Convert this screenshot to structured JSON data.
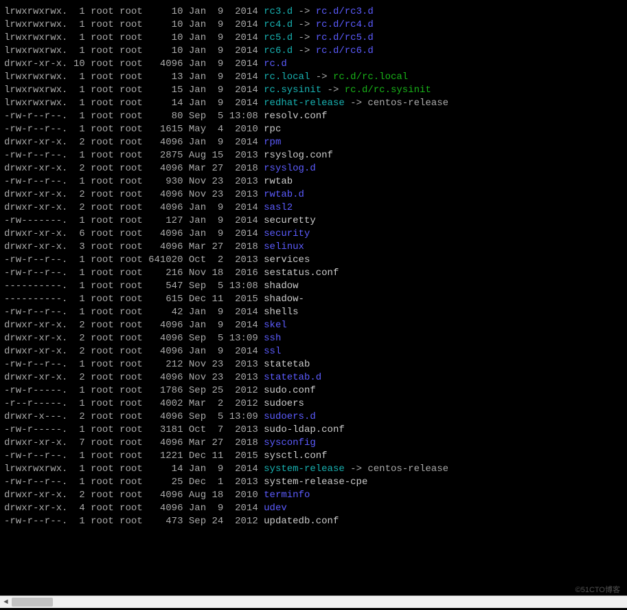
{
  "watermark": "©51CTO博客",
  "rows": [
    {
      "perm": "lrwxrwxrwx.",
      "links": "1",
      "owner": "root",
      "group": "root",
      "size": "10",
      "month": "Jan",
      "day": "9",
      "time": "2014",
      "name": "rc3.d",
      "nameType": "link",
      "arrow": " -> ",
      "target": "rc.d/rc3.d",
      "targetType": "dir"
    },
    {
      "perm": "lrwxrwxrwx.",
      "links": "1",
      "owner": "root",
      "group": "root",
      "size": "10",
      "month": "Jan",
      "day": "9",
      "time": "2014",
      "name": "rc4.d",
      "nameType": "link",
      "arrow": " -> ",
      "target": "rc.d/rc4.d",
      "targetType": "dir"
    },
    {
      "perm": "lrwxrwxrwx.",
      "links": "1",
      "owner": "root",
      "group": "root",
      "size": "10",
      "month": "Jan",
      "day": "9",
      "time": "2014",
      "name": "rc5.d",
      "nameType": "link",
      "arrow": " -> ",
      "target": "rc.d/rc5.d",
      "targetType": "dir"
    },
    {
      "perm": "lrwxrwxrwx.",
      "links": "1",
      "owner": "root",
      "group": "root",
      "size": "10",
      "month": "Jan",
      "day": "9",
      "time": "2014",
      "name": "rc6.d",
      "nameType": "link",
      "arrow": " -> ",
      "target": "rc.d/rc6.d",
      "targetType": "dir"
    },
    {
      "perm": "drwxr-xr-x.",
      "links": "10",
      "owner": "root",
      "group": "root",
      "size": "4096",
      "month": "Jan",
      "day": "9",
      "time": "2014",
      "name": "rc.d",
      "nameType": "dir"
    },
    {
      "perm": "lrwxrwxrwx.",
      "links": "1",
      "owner": "root",
      "group": "root",
      "size": "13",
      "month": "Jan",
      "day": "9",
      "time": "2014",
      "name": "rc.local",
      "nameType": "link",
      "arrow": " -> ",
      "target": "rc.d/rc.local",
      "targetType": "exec"
    },
    {
      "perm": "lrwxrwxrwx.",
      "links": "1",
      "owner": "root",
      "group": "root",
      "size": "15",
      "month": "Jan",
      "day": "9",
      "time": "2014",
      "name": "rc.sysinit",
      "nameType": "link",
      "arrow": " -> ",
      "target": "rc.d/rc.sysinit",
      "targetType": "exec"
    },
    {
      "perm": "lrwxrwxrwx.",
      "links": "1",
      "owner": "root",
      "group": "root",
      "size": "14",
      "month": "Jan",
      "day": "9",
      "time": "2014",
      "name": "redhat-release",
      "nameType": "link",
      "arrow": " -> ",
      "target": "centos-release",
      "targetType": "plain"
    },
    {
      "perm": "-rw-r--r--.",
      "links": "1",
      "owner": "root",
      "group": "root",
      "size": "80",
      "month": "Sep",
      "day": "5",
      "time": "13:08",
      "name": "resolv.conf",
      "nameType": "plain"
    },
    {
      "perm": "-rw-r--r--.",
      "links": "1",
      "owner": "root",
      "group": "root",
      "size": "1615",
      "month": "May",
      "day": "4",
      "time": "2010",
      "name": "rpc",
      "nameType": "plain"
    },
    {
      "perm": "drwxr-xr-x.",
      "links": "2",
      "owner": "root",
      "group": "root",
      "size": "4096",
      "month": "Jan",
      "day": "9",
      "time": "2014",
      "name": "rpm",
      "nameType": "dir"
    },
    {
      "perm": "-rw-r--r--.",
      "links": "1",
      "owner": "root",
      "group": "root",
      "size": "2875",
      "month": "Aug",
      "day": "15",
      "time": "2013",
      "name": "rsyslog.conf",
      "nameType": "plain"
    },
    {
      "perm": "drwxr-xr-x.",
      "links": "2",
      "owner": "root",
      "group": "root",
      "size": "4096",
      "month": "Mar",
      "day": "27",
      "time": "2018",
      "name": "rsyslog.d",
      "nameType": "dir"
    },
    {
      "perm": "-rw-r--r--.",
      "links": "1",
      "owner": "root",
      "group": "root",
      "size": "930",
      "month": "Nov",
      "day": "23",
      "time": "2013",
      "name": "rwtab",
      "nameType": "plain"
    },
    {
      "perm": "drwxr-xr-x.",
      "links": "2",
      "owner": "root",
      "group": "root",
      "size": "4096",
      "month": "Nov",
      "day": "23",
      "time": "2013",
      "name": "rwtab.d",
      "nameType": "dir"
    },
    {
      "perm": "drwxr-xr-x.",
      "links": "2",
      "owner": "root",
      "group": "root",
      "size": "4096",
      "month": "Jan",
      "day": "9",
      "time": "2014",
      "name": "sasl2",
      "nameType": "dir"
    },
    {
      "perm": "-rw-------.",
      "links": "1",
      "owner": "root",
      "group": "root",
      "size": "127",
      "month": "Jan",
      "day": "9",
      "time": "2014",
      "name": "securetty",
      "nameType": "plain"
    },
    {
      "perm": "drwxr-xr-x.",
      "links": "6",
      "owner": "root",
      "group": "root",
      "size": "4096",
      "month": "Jan",
      "day": "9",
      "time": "2014",
      "name": "security",
      "nameType": "dir"
    },
    {
      "perm": "drwxr-xr-x.",
      "links": "3",
      "owner": "root",
      "group": "root",
      "size": "4096",
      "month": "Mar",
      "day": "27",
      "time": "2018",
      "name": "selinux",
      "nameType": "dir"
    },
    {
      "perm": "-rw-r--r--.",
      "links": "1",
      "owner": "root",
      "group": "root",
      "size": "641020",
      "month": "Oct",
      "day": "2",
      "time": "2013",
      "name": "services",
      "nameType": "plain"
    },
    {
      "perm": "-rw-r--r--.",
      "links": "1",
      "owner": "root",
      "group": "root",
      "size": "216",
      "month": "Nov",
      "day": "18",
      "time": "2016",
      "name": "sestatus.conf",
      "nameType": "plain"
    },
    {
      "perm": "----------.",
      "links": "1",
      "owner": "root",
      "group": "root",
      "size": "547",
      "month": "Sep",
      "day": "5",
      "time": "13:08",
      "name": "shadow",
      "nameType": "plain"
    },
    {
      "perm": "----------.",
      "links": "1",
      "owner": "root",
      "group": "root",
      "size": "615",
      "month": "Dec",
      "day": "11",
      "time": "2015",
      "name": "shadow-",
      "nameType": "plain"
    },
    {
      "perm": "-rw-r--r--.",
      "links": "1",
      "owner": "root",
      "group": "root",
      "size": "42",
      "month": "Jan",
      "day": "9",
      "time": "2014",
      "name": "shells",
      "nameType": "plain"
    },
    {
      "perm": "drwxr-xr-x.",
      "links": "2",
      "owner": "root",
      "group": "root",
      "size": "4096",
      "month": "Jan",
      "day": "9",
      "time": "2014",
      "name": "skel",
      "nameType": "dir"
    },
    {
      "perm": "drwxr-xr-x.",
      "links": "2",
      "owner": "root",
      "group": "root",
      "size": "4096",
      "month": "Sep",
      "day": "5",
      "time": "13:09",
      "name": "ssh",
      "nameType": "dir"
    },
    {
      "perm": "drwxr-xr-x.",
      "links": "2",
      "owner": "root",
      "group": "root",
      "size": "4096",
      "month": "Jan",
      "day": "9",
      "time": "2014",
      "name": "ssl",
      "nameType": "dir"
    },
    {
      "perm": "-rw-r--r--.",
      "links": "1",
      "owner": "root",
      "group": "root",
      "size": "212",
      "month": "Nov",
      "day": "23",
      "time": "2013",
      "name": "statetab",
      "nameType": "plain"
    },
    {
      "perm": "drwxr-xr-x.",
      "links": "2",
      "owner": "root",
      "group": "root",
      "size": "4096",
      "month": "Nov",
      "day": "23",
      "time": "2013",
      "name": "statetab.d",
      "nameType": "dir"
    },
    {
      "perm": "-rw-r-----.",
      "links": "1",
      "owner": "root",
      "group": "root",
      "size": "1786",
      "month": "Sep",
      "day": "25",
      "time": "2012",
      "name": "sudo.conf",
      "nameType": "plain"
    },
    {
      "perm": "-r--r-----.",
      "links": "1",
      "owner": "root",
      "group": "root",
      "size": "4002",
      "month": "Mar",
      "day": "2",
      "time": "2012",
      "name": "sudoers",
      "nameType": "plain"
    },
    {
      "perm": "drwxr-x---.",
      "links": "2",
      "owner": "root",
      "group": "root",
      "size": "4096",
      "month": "Sep",
      "day": "5",
      "time": "13:09",
      "name": "sudoers.d",
      "nameType": "dir"
    },
    {
      "perm": "-rw-r-----.",
      "links": "1",
      "owner": "root",
      "group": "root",
      "size": "3181",
      "month": "Oct",
      "day": "7",
      "time": "2013",
      "name": "sudo-ldap.conf",
      "nameType": "plain"
    },
    {
      "perm": "drwxr-xr-x.",
      "links": "7",
      "owner": "root",
      "group": "root",
      "size": "4096",
      "month": "Mar",
      "day": "27",
      "time": "2018",
      "name": "sysconfig",
      "nameType": "dir"
    },
    {
      "perm": "-rw-r--r--.",
      "links": "1",
      "owner": "root",
      "group": "root",
      "size": "1221",
      "month": "Dec",
      "day": "11",
      "time": "2015",
      "name": "sysctl.conf",
      "nameType": "plain"
    },
    {
      "perm": "lrwxrwxrwx.",
      "links": "1",
      "owner": "root",
      "group": "root",
      "size": "14",
      "month": "Jan",
      "day": "9",
      "time": "2014",
      "name": "system-release",
      "nameType": "link",
      "arrow": " -> ",
      "target": "centos-release",
      "targetType": "plain"
    },
    {
      "perm": "-rw-r--r--.",
      "links": "1",
      "owner": "root",
      "group": "root",
      "size": "25",
      "month": "Dec",
      "day": "1",
      "time": "2013",
      "name": "system-release-cpe",
      "nameType": "plain"
    },
    {
      "perm": "drwxr-xr-x.",
      "links": "2",
      "owner": "root",
      "group": "root",
      "size": "4096",
      "month": "Aug",
      "day": "18",
      "time": "2010",
      "name": "terminfo",
      "nameType": "dir"
    },
    {
      "perm": "drwxr-xr-x.",
      "links": "4",
      "owner": "root",
      "group": "root",
      "size": "4096",
      "month": "Jan",
      "day": "9",
      "time": "2014",
      "name": "udev",
      "nameType": "dir"
    },
    {
      "perm": "-rw-r--r--.",
      "links": "1",
      "owner": "root",
      "group": "root",
      "size": "473",
      "month": "Sep",
      "day": "24",
      "time": "2012",
      "name": "updatedb.conf",
      "nameType": "plain"
    }
  ]
}
